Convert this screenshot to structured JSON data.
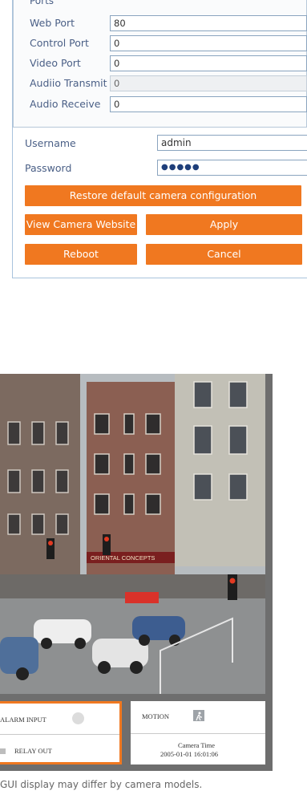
{
  "ports": {
    "legend": "Ports",
    "rows": [
      {
        "label": "Web Port",
        "value": "80",
        "disabled": false
      },
      {
        "label": "Control Port",
        "value": "0",
        "disabled": false
      },
      {
        "label": "Video Port",
        "value": "0",
        "disabled": false
      },
      {
        "label": "Audiio Transmit",
        "value": "0",
        "disabled": true
      },
      {
        "label": "Audio Receive",
        "value": "0",
        "disabled": false
      }
    ]
  },
  "credentials": {
    "username_label": "Username",
    "username_value": "admin",
    "password_label": "Password",
    "password_value": "●●●●●"
  },
  "buttons": {
    "restore": "Restore default camera configuration",
    "view_website": "View Camera Website",
    "apply": "Apply",
    "reboot": "Reboot",
    "cancel": "Cancel"
  },
  "viewer": {
    "sign_text": "ORIENTAL CONCEPTS",
    "alarm_input_label": "ALARM INPUT",
    "relay_out_label": "RELAY OUT",
    "motion_label": "MOTION",
    "camera_time_label": "Camera Time",
    "camera_time_value": "2005-01-01 16:01:06"
  },
  "caption": "GUI display may differ by camera models.",
  "colors": {
    "accent": "#f07820",
    "label_text": "#4a5f86",
    "viewer_frame": "#6e6e6e"
  }
}
